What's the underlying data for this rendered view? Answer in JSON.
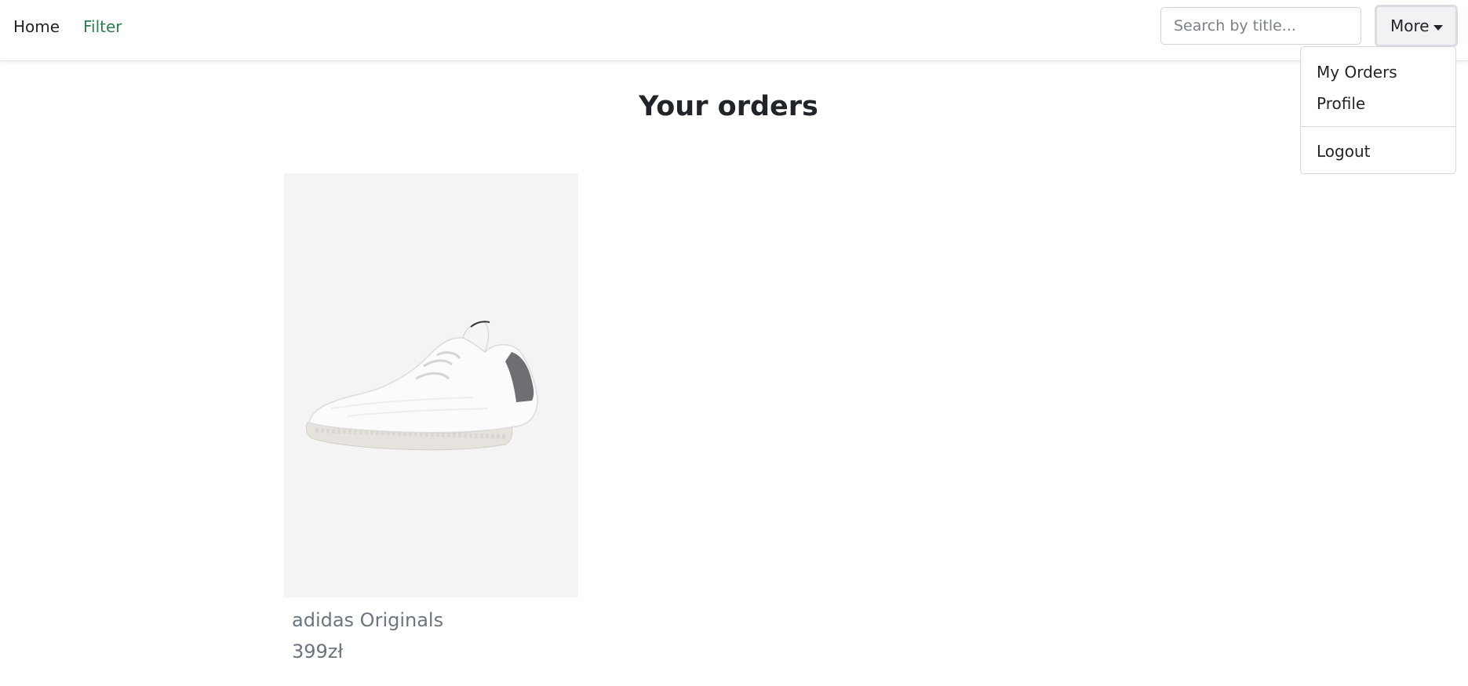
{
  "navbar": {
    "home_label": "Home",
    "filter_label": "Filter",
    "search_placeholder": "Search by title...",
    "search_value": "",
    "more_label": "More"
  },
  "dropdown": {
    "items": [
      {
        "label": "My Orders"
      },
      {
        "label": "Profile"
      },
      {
        "label": "Logout"
      }
    ]
  },
  "main": {
    "title": "Your orders",
    "orders": [
      {
        "brand": "adidas Originals",
        "price": "399zł",
        "image_icon": "white-sneaker-image"
      }
    ]
  },
  "colors": {
    "filter_link": "#2e7d4f",
    "card_background": "#f4f4f4",
    "muted_text": "#6c757d"
  }
}
